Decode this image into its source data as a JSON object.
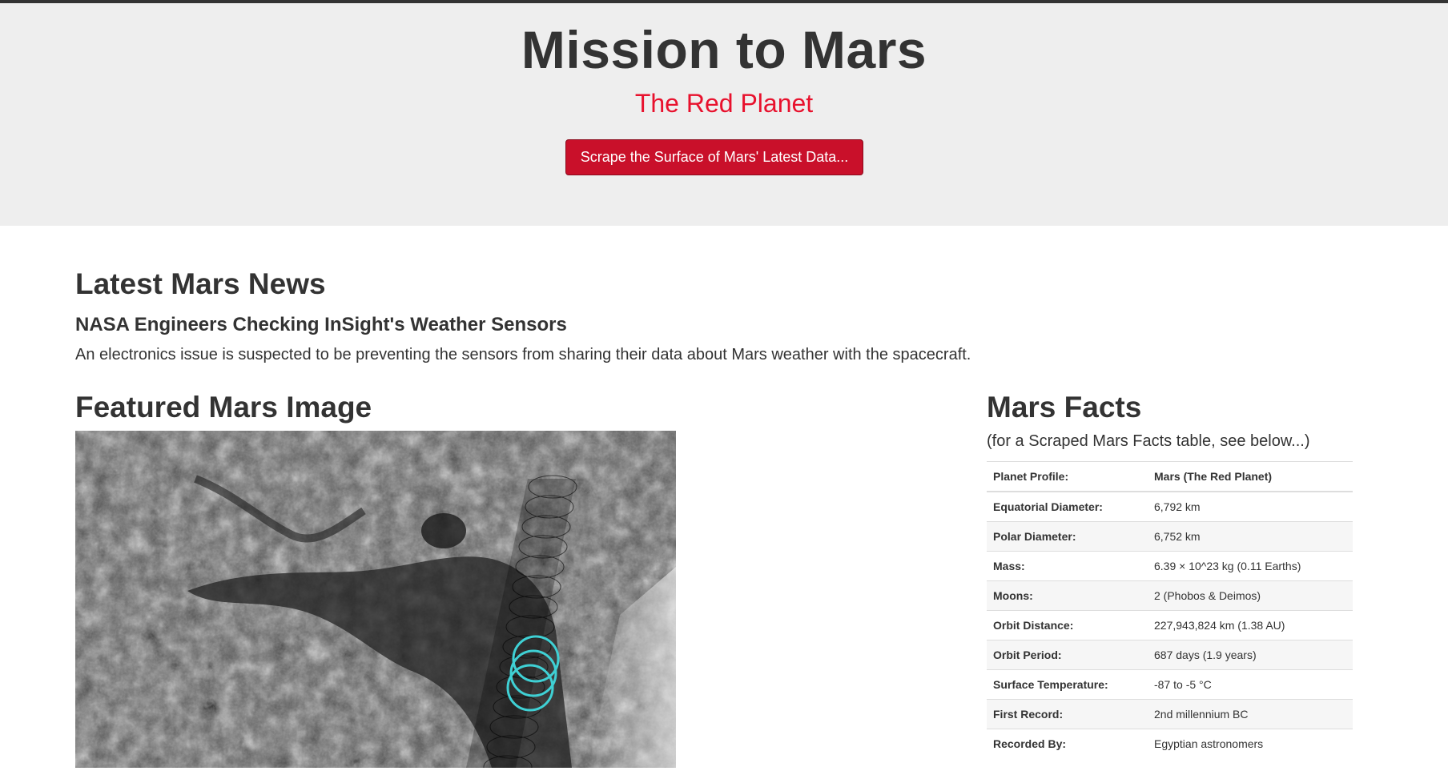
{
  "header": {
    "title": "Mission to Mars",
    "subtitle": "The Red Planet",
    "scrape_button": "Scrape the Surface of Mars' Latest Data..."
  },
  "news": {
    "section_title": "Latest Mars News",
    "headline": "NASA Engineers Checking InSight's Weather Sensors",
    "teaser": "An electronics issue is suspected to be preventing the sensors from sharing their data about Mars weather with the spacecraft."
  },
  "featured_image": {
    "section_title": "Featured Mars Image"
  },
  "facts": {
    "section_title": "Mars Facts",
    "subtitle": "(for a Scraped Mars Facts table, see below...)",
    "rows": [
      {
        "label": "Planet Profile:",
        "value": "Mars (The Red Planet)"
      },
      {
        "label": "Equatorial Diameter:",
        "value": "6,792 km"
      },
      {
        "label": "Polar Diameter:",
        "value": "6,752 km"
      },
      {
        "label": "Mass:",
        "value": "6.39 × 10^23 kg (0.11 Earths)"
      },
      {
        "label": "Moons:",
        "value": "2 (Phobos & Deimos)"
      },
      {
        "label": "Orbit Distance:",
        "value": "227,943,824 km (1.38 AU)"
      },
      {
        "label": "Orbit Period:",
        "value": "687 days (1.9 years)"
      },
      {
        "label": "Surface Temperature:",
        "value": "-87 to -5 °C"
      },
      {
        "label": "First Record:",
        "value": "2nd millennium BC"
      },
      {
        "label": "Recorded By:",
        "value": "Egyptian astronomers"
      }
    ]
  },
  "colors": {
    "accent_red": "#e8112d",
    "button_red": "#c9102a",
    "jumbotron_bg": "#eeeeee"
  }
}
